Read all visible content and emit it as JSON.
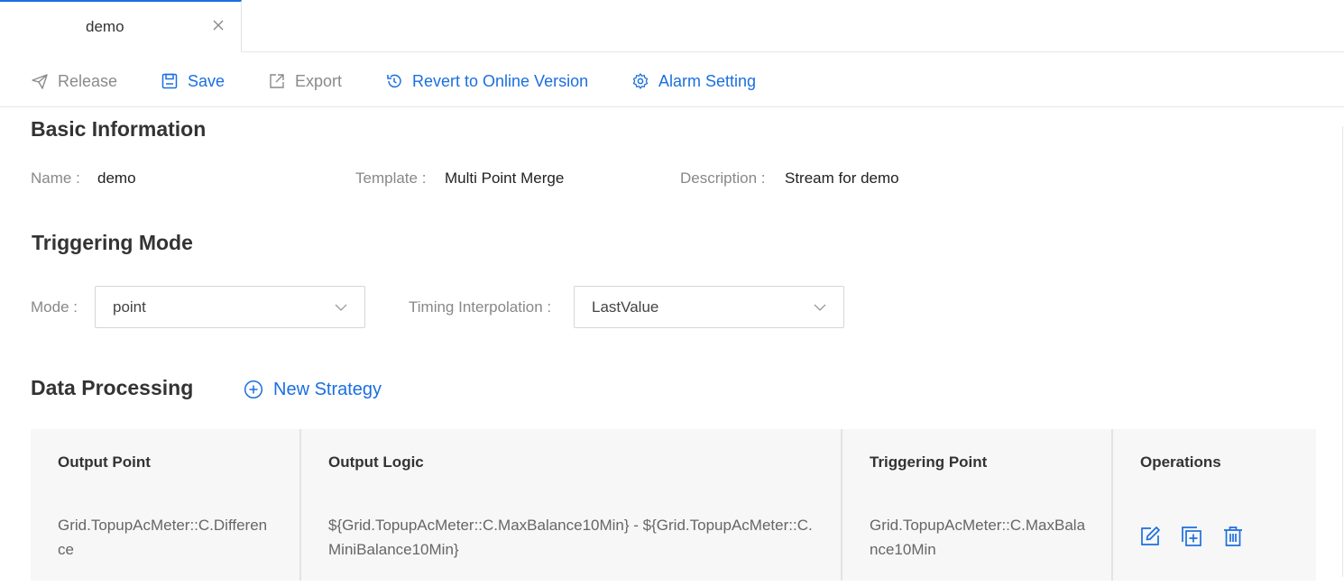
{
  "tabs": [
    {
      "label": "demo",
      "active": true
    }
  ],
  "toolbar": {
    "release_label": "Release",
    "save_label": "Save",
    "export_label": "Export",
    "revert_label": "Revert to Online Version",
    "alarm_label": "Alarm Setting"
  },
  "basic_info": {
    "title": "Basic Information",
    "name_label": "Name",
    "name_value": "demo",
    "template_label": "Template",
    "template_value": "Multi Point Merge",
    "description_label": "Description",
    "description_value": "Stream for demo"
  },
  "triggering": {
    "title": "Triggering Mode",
    "mode_label": "Mode",
    "mode_value": "point",
    "interpolation_label": "Timing Interpolation",
    "interpolation_value": "LastValue"
  },
  "data_processing": {
    "title": "Data Processing",
    "new_strategy_label": "New Strategy",
    "columns": [
      "Output Point",
      "Output Logic",
      "Triggering Point",
      "Operations"
    ],
    "rows": [
      {
        "output_point": "Grid.TopupAcMeter::C.Difference",
        "output_logic": "${Grid.TopupAcMeter::C.MaxBalance10Min} - ${Grid.TopupAcMeter::C.MiniBalance10Min}",
        "triggering_point": "Grid.TopupAcMeter::C.MaxBalance10Min"
      }
    ]
  },
  "colors": {
    "accent": "#1b6fe0",
    "muted": "#888888",
    "table_bg": "#f7f7f7"
  }
}
